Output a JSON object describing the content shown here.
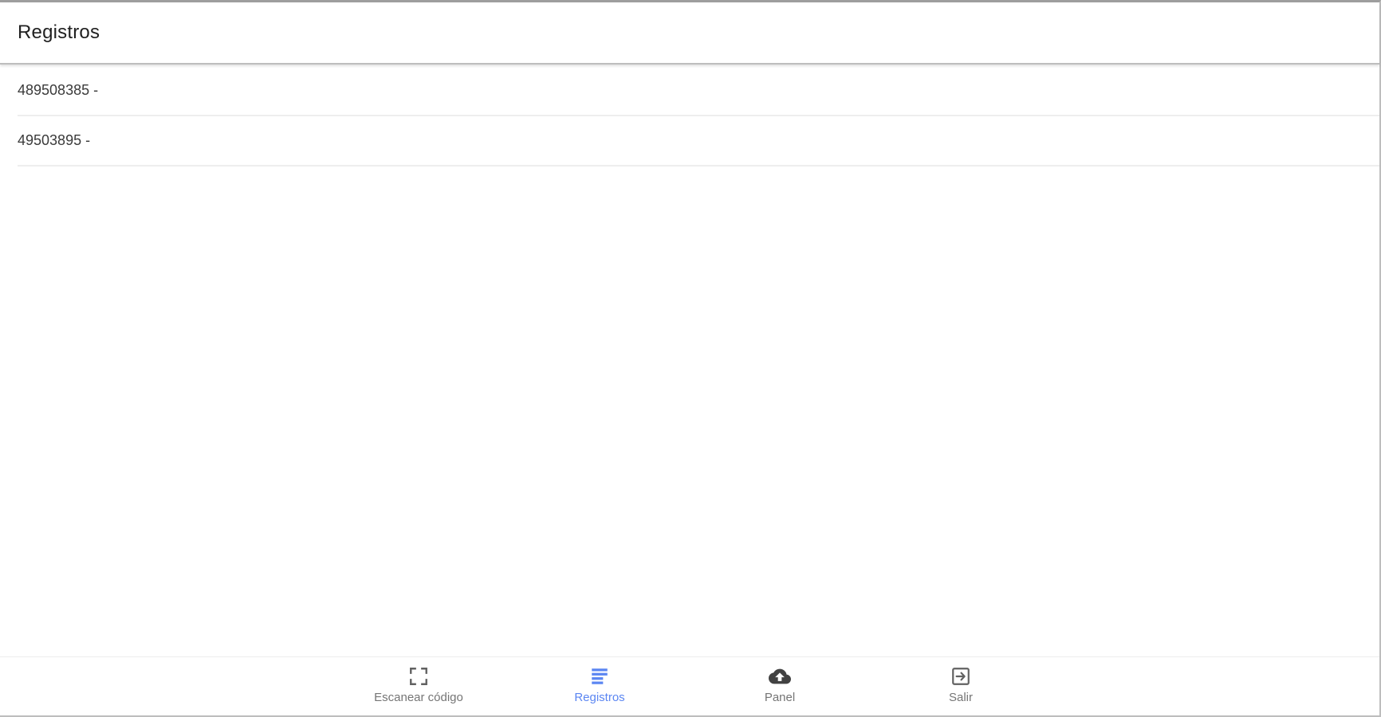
{
  "header": {
    "title": "Registros"
  },
  "records": [
    {
      "text": "489508385 -"
    },
    {
      "text": "49503895 -"
    }
  ],
  "bottom_nav": {
    "items": [
      {
        "label": "Escanear código",
        "icon": "scan-frame-icon",
        "active": false
      },
      {
        "label": "Registros",
        "icon": "list-icon",
        "active": true
      },
      {
        "label": "Panel",
        "icon": "cloud-upload-icon",
        "active": false
      },
      {
        "label": "Salir",
        "icon": "logout-icon",
        "active": false
      }
    ],
    "active_color": "#5b86f2",
    "inactive_color": "#757575"
  }
}
